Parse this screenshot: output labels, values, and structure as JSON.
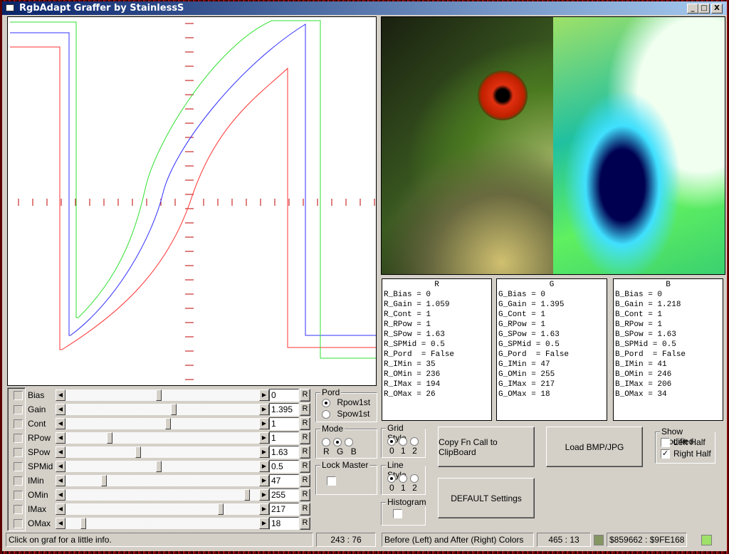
{
  "window": {
    "title": "RgbAdapt Graffer by StainlessS",
    "min": "_",
    "max": "□",
    "close": "X"
  },
  "sliders": [
    {
      "label": "Bias",
      "value": "0",
      "pos": 0.48
    },
    {
      "label": "Gain",
      "value": "1.395",
      "pos": 0.56
    },
    {
      "label": "Cont",
      "value": "1",
      "pos": 0.53
    },
    {
      "label": "RPow",
      "value": "1",
      "pos": 0.22
    },
    {
      "label": "SPow",
      "value": "1.63",
      "pos": 0.37
    },
    {
      "label": "SPMid",
      "value": "0.5",
      "pos": 0.48
    },
    {
      "label": "IMin",
      "value": "47",
      "pos": 0.19
    },
    {
      "label": "OMin",
      "value": "255",
      "pos": 0.95
    },
    {
      "label": "IMax",
      "value": "217",
      "pos": 0.81
    },
    {
      "label": "OMax",
      "value": "18",
      "pos": 0.08
    }
  ],
  "reset_label": "R",
  "pord": {
    "title": "Pord",
    "options": [
      "Rpow1st",
      "Spow1st"
    ],
    "selected": 0
  },
  "mode": {
    "title": "Mode",
    "options": [
      "R",
      "G",
      "B"
    ],
    "selected": 1
  },
  "lock_master": {
    "title": "Lock Master",
    "checked": false
  },
  "grid_style": {
    "title": "Grid Style",
    "options": [
      "0",
      "1",
      "2"
    ],
    "selected": 0
  },
  "line_style": {
    "title": "Line Style",
    "options": [
      "0",
      "1",
      "2"
    ],
    "selected": 0
  },
  "histogram": {
    "title": "Histogram",
    "checked": false
  },
  "buttons": {
    "copy": "Copy Fn Call to ClipBoard",
    "load": "Load BMP/JPG",
    "default": "DEFAULT Settings"
  },
  "show_modified": {
    "title": "Show Modified",
    "left": "Left Half",
    "right": "Right Half",
    "left_checked": false,
    "right_checked": true
  },
  "panels": [
    {
      "header": "R",
      "lines": [
        "R_Bias = 0",
        "R_Gain = 1.059",
        "R_Cont = 1",
        "R_RPow = 1",
        "R_SPow = 1.63",
        "R_SPMid = 0.5",
        "R_Pord  = False",
        "R_IMin = 35",
        "R_OMin = 236",
        "R_IMax = 194",
        "R_OMax = 26"
      ]
    },
    {
      "header": "G",
      "lines": [
        "G_Bias = 0",
        "G_Gain = 1.395",
        "G_Cont = 1",
        "G_RPow = 1",
        "G_SPow = 1.63",
        "G_SPMid = 0.5",
        "G_Pord  = False",
        "G_IMin = 47",
        "G_OMin = 255",
        "G_IMax = 217",
        "G_OMax = 18"
      ]
    },
    {
      "header": "B",
      "lines": [
        "B_Bias = 0",
        "B_Gain = 1.218",
        "B_Cont = 1",
        "B_RPow = 1",
        "B_SPow = 1.63",
        "B_SPMid = 0.5",
        "B_Pord  = False",
        "B_IMin = 41",
        "B_OMin = 246",
        "B_IMax = 206",
        "B_OMax = 34"
      ]
    }
  ],
  "status": {
    "info": "Click on graf for a little info.",
    "graph_coord": "243 : 76",
    "colors_label": "Before (Left) and After (Right) Colors",
    "image_coord": "465 : 13",
    "colors_hex": "$859662 : $9FE168",
    "before_color": "#859662",
    "after_color": "#9FE168"
  }
}
